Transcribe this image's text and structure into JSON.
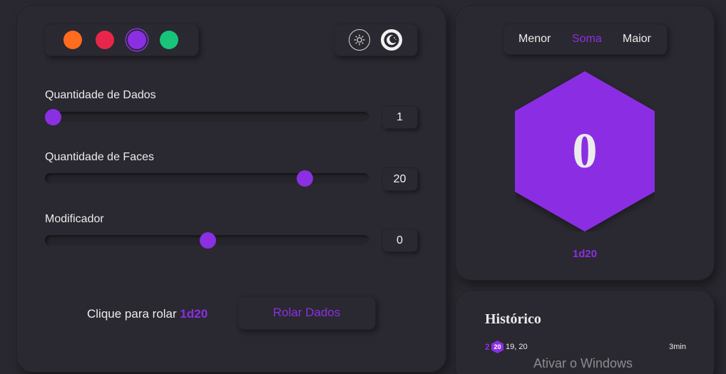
{
  "theme": {
    "accent": "#8b2fe3",
    "palette": [
      {
        "name": "orange",
        "color": "#ff6b1f"
      },
      {
        "name": "red",
        "color": "#e8264a"
      },
      {
        "name": "purple",
        "color": "#8b2fe3",
        "selected": true
      },
      {
        "name": "green",
        "color": "#17c47a"
      }
    ],
    "light_icon": "sun-icon",
    "dark_icon": "moon-icon"
  },
  "controls": {
    "dice_count": {
      "label": "Quantidade de Dados",
      "value": "1",
      "level": 0.0
    },
    "faces": {
      "label": "Quantidade de Faces",
      "value": "20",
      "level": 0.815
    },
    "modifier": {
      "label": "Modificador",
      "value": "0",
      "level": 0.5
    }
  },
  "roll": {
    "hint_prefix": "Clique para rolar",
    "notation": "1d20",
    "button_label": "Rolar Dados"
  },
  "modes": {
    "items": [
      "Menor",
      "Soma",
      "Maior"
    ],
    "selected": "Soma"
  },
  "die": {
    "value": "0",
    "notation": "1d20"
  },
  "history": {
    "title": "Histórico",
    "entries": [
      {
        "total": "2",
        "die": "20",
        "rolls": "19, 20",
        "time": "3min"
      }
    ]
  },
  "watermark": "Ativar o Windows"
}
